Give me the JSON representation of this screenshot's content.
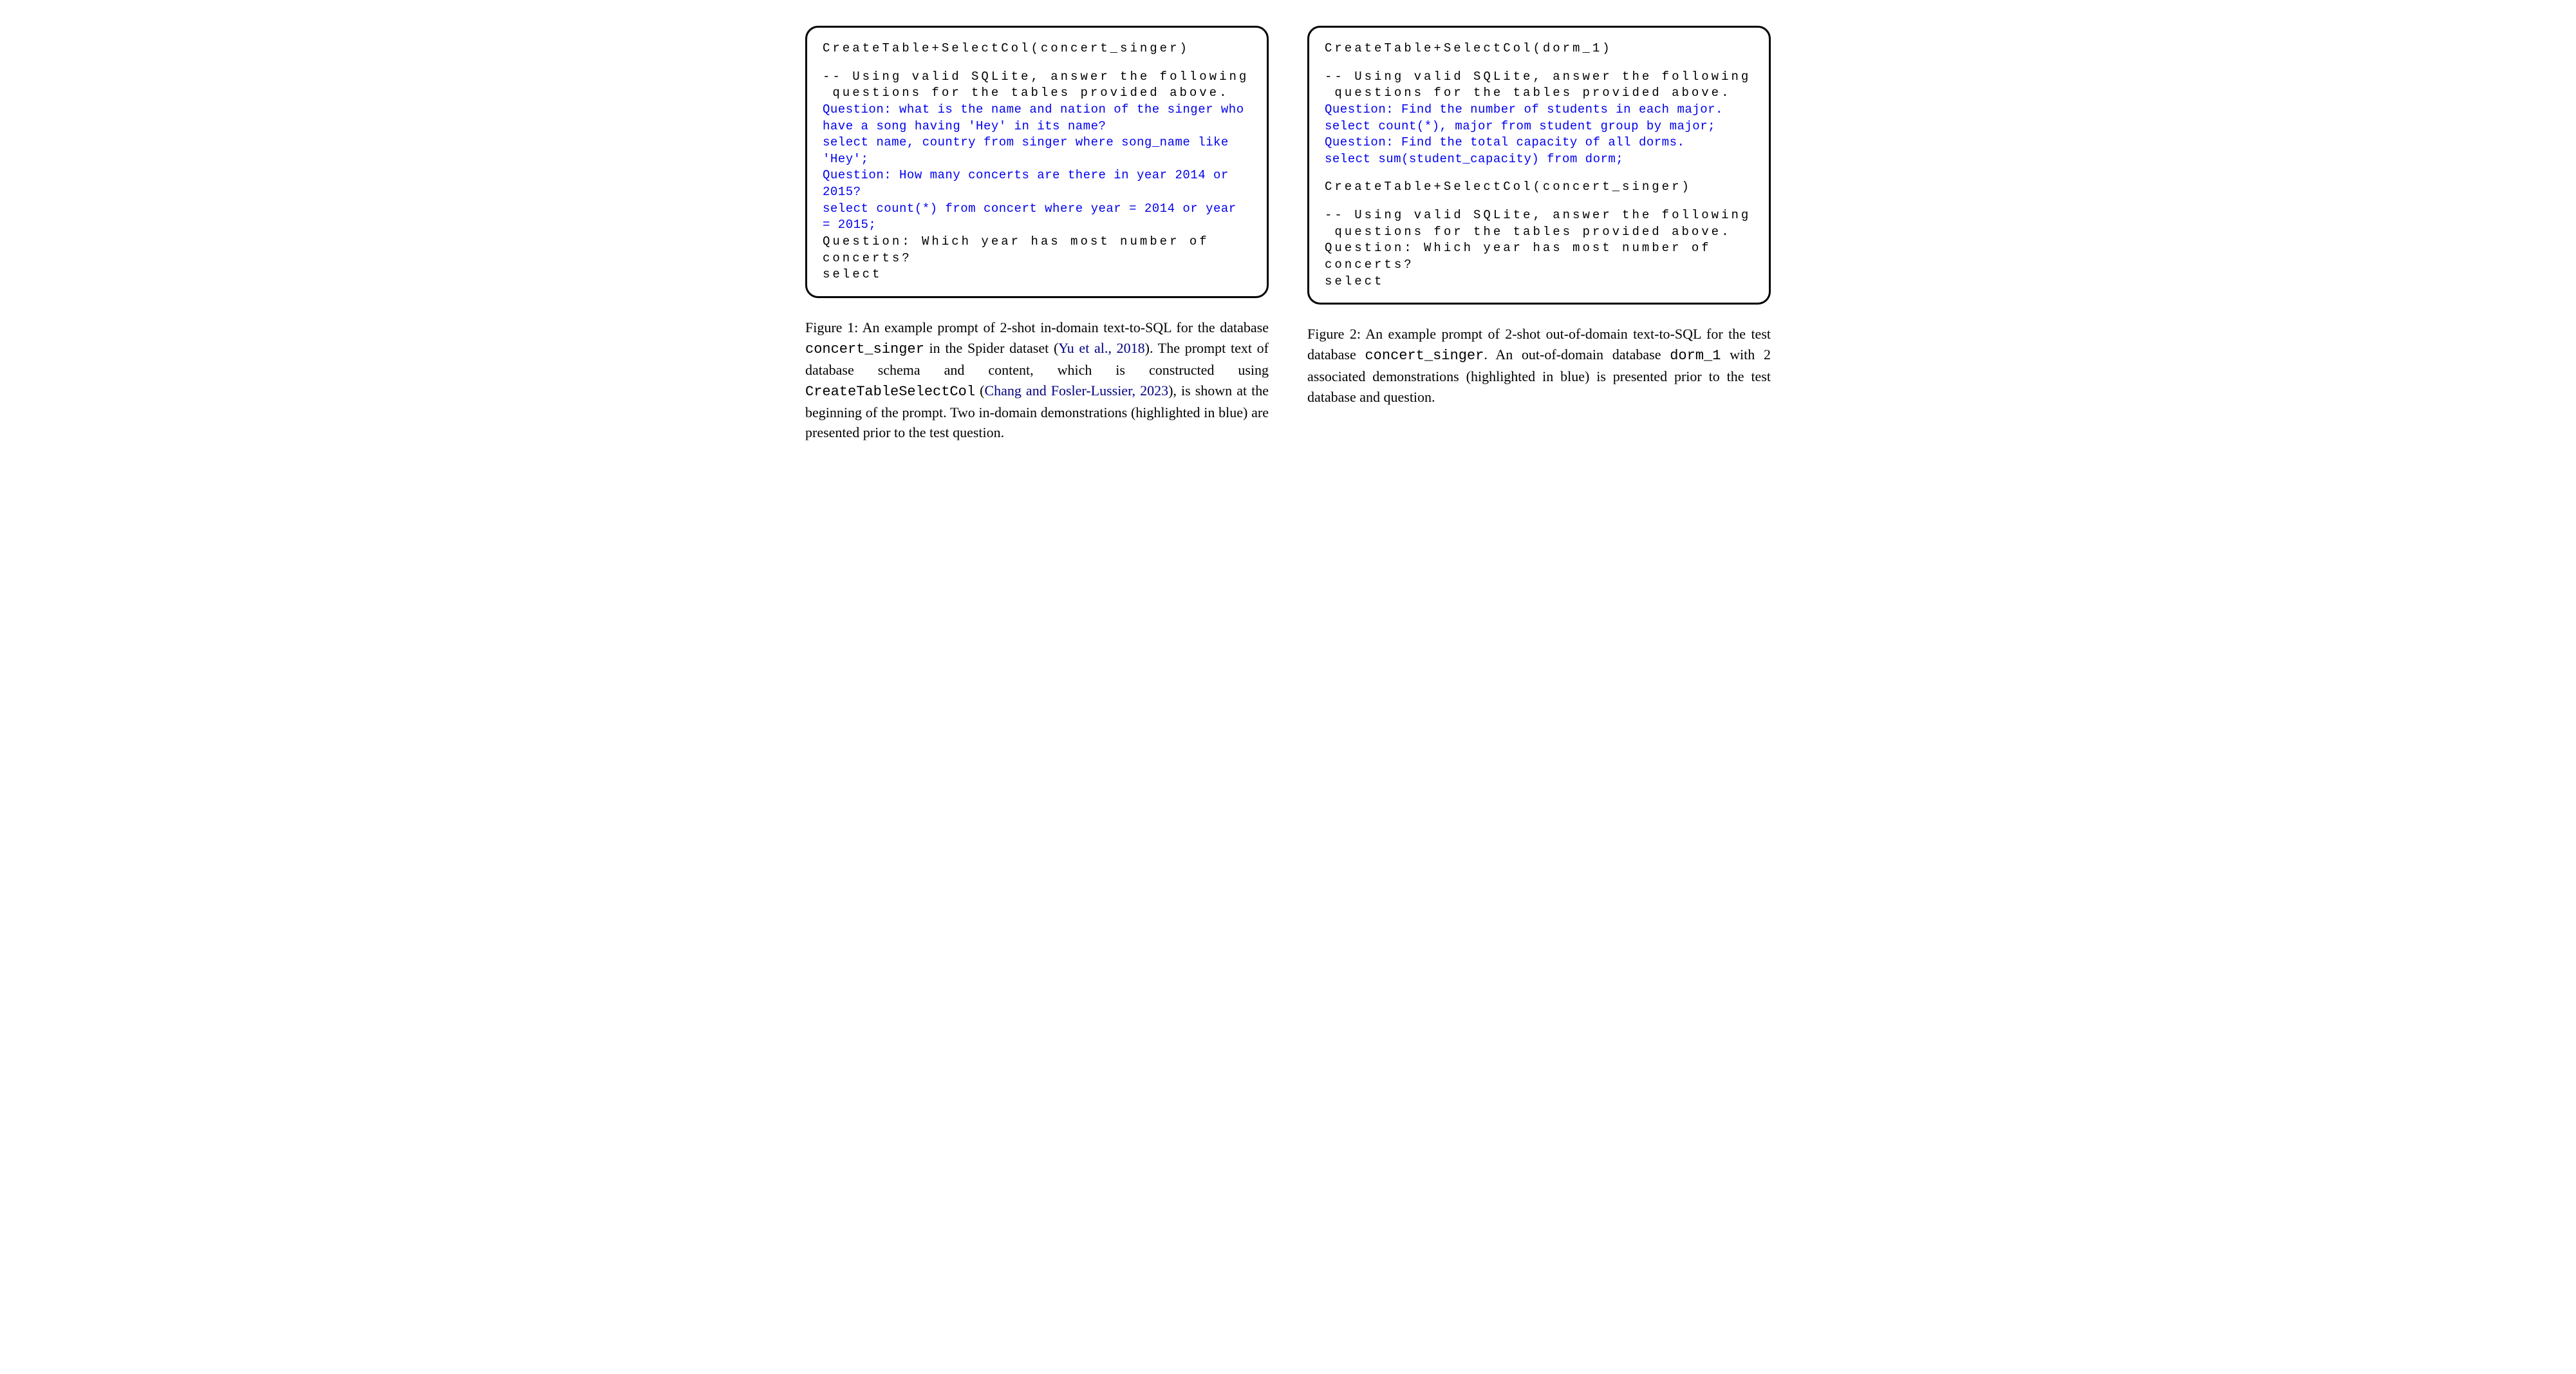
{
  "left": {
    "code": {
      "line1": "CreateTable+SelectCol(concert_singer)",
      "line2": "-- Using valid SQLite, answer the following",
      "line3": " questions for the tables provided above.",
      "blue1": "Question: what is the name and nation of the singer who have a song having 'Hey' in its name?",
      "blue2": "select name, country from singer where song_name like 'Hey';",
      "blue3": "Question: How many concerts are there in year 2014 or 2015?",
      "blue4": "select count(*) from concert where year = 2014 or year = 2015;",
      "line4": "Question: Which year has most number of concerts?",
      "line5": "select"
    },
    "caption": {
      "prefix": "Figure 1:  An example prompt of 2-shot in-domain text-to-SQL for the database ",
      "mono1": "concert_singer",
      "mid1": " in the Spider dataset (",
      "cite1": "Yu et al., 2018",
      "mid2": ").  The prompt text of database schema and content, which is constructed using ",
      "mono2": "CreateTableSelectCol",
      "mid3": " (",
      "cite2": "Chang and Fosler-Lussier, 2023",
      "suffix": "), is shown at the beginning of the prompt.  Two in-domain demonstrations (highlighted in blue) are presented prior to the test question."
    }
  },
  "right": {
    "code": {
      "line1": "CreateTable+SelectCol(dorm_1)",
      "line2": "-- Using valid SQLite, answer the following",
      "line3": " questions for the tables provided above.",
      "blue1": "Question: Find the number of students in each major.",
      "blue2": "select count(*), major from student group by major;",
      "blue3": "Question: Find the total capacity of all dorms.",
      "blue4": "select sum(student_capacity) from dorm;",
      "line4": "CreateTable+SelectCol(concert_singer)",
      "line5": "-- Using valid SQLite, answer the following",
      "line6": " questions for the tables provided above.",
      "line7": "Question: Which year has most number of concerts?",
      "line8": "select"
    },
    "caption": {
      "prefix": "Figure 2: An example prompt of 2-shot out-of-domain text-to-SQL for the test database ",
      "mono1": "concert_singer",
      "mid1": ". An out-of-domain database ",
      "mono2": "dorm_1",
      "suffix": " with 2 associated demonstrations (highlighted in blue) is presented prior to the test database and question."
    }
  }
}
